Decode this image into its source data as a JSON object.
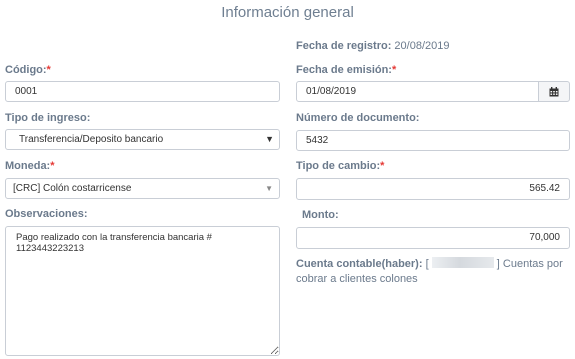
{
  "title": "Información general",
  "registro": {
    "label": "Fecha de registro:",
    "value": "20/08/2019"
  },
  "codigo": {
    "label": "Código:",
    "required_mark": "*",
    "value": "0001"
  },
  "fecha_emision": {
    "label": "Fecha de emisión:",
    "required_mark": "*",
    "value": "01/08/2019",
    "button_icon": "calendar-icon"
  },
  "tipo_ingreso": {
    "label": "Tipo de ingreso:",
    "selected": "Transferencia/Deposito bancario"
  },
  "numero_documento": {
    "label": "Número de documento:",
    "value": "5432"
  },
  "moneda": {
    "label": "Moneda:",
    "required_mark": "*",
    "selected": "[CRC] Colón costarricense"
  },
  "tipo_cambio": {
    "label": "Tipo de cambio:",
    "required_mark": "*",
    "value": "565.42"
  },
  "observaciones": {
    "label": "Observaciones:",
    "value": "Pago realizado con la transferencia bancaria # 1123443223213"
  },
  "monto": {
    "label": "Monto:",
    "value": "70,000"
  },
  "cuenta_contable": {
    "label": "Cuenta contable(haber):",
    "open_bracket": "[",
    "close_bracket": "]",
    "text": "Cuentas por cobrar a clientes colones"
  },
  "colors": {
    "label": "#6b7a8c",
    "required": "#e53935",
    "border": "#c9ced6"
  }
}
